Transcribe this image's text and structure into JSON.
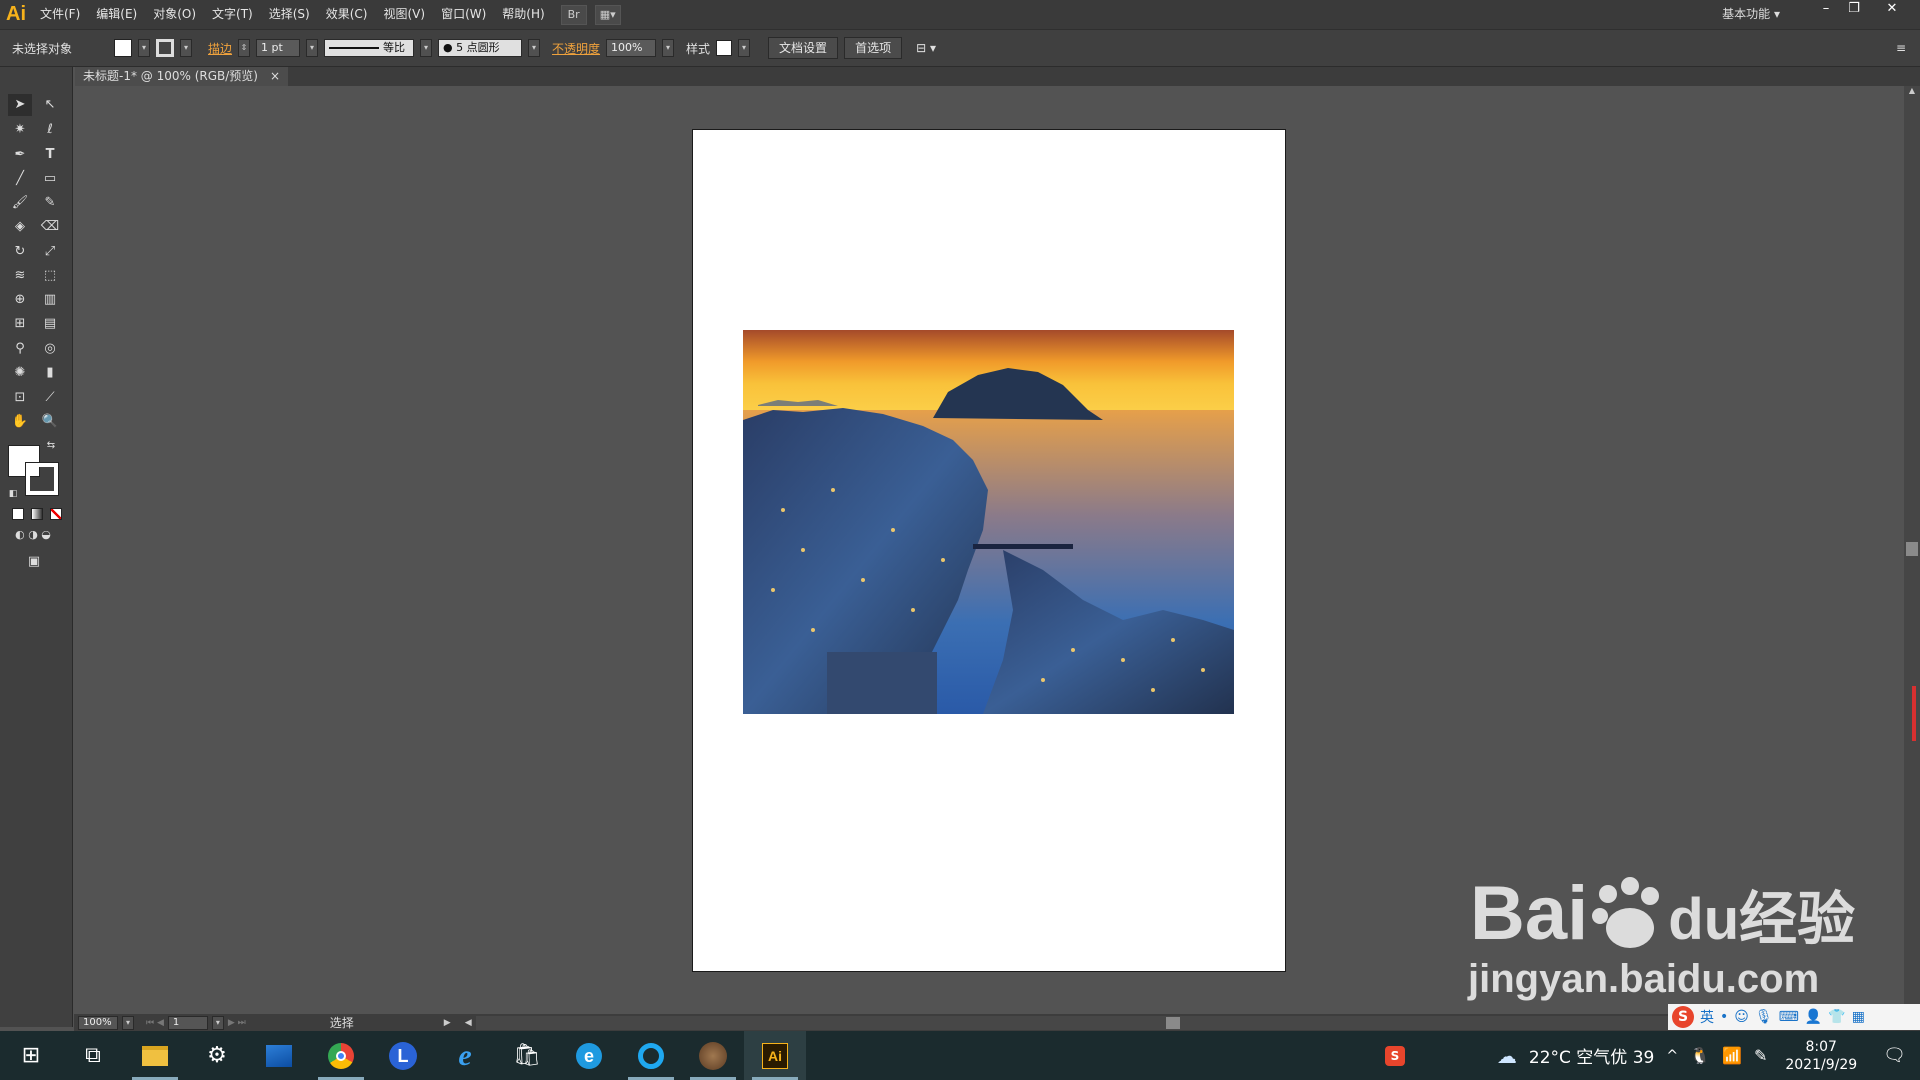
{
  "app": {
    "logo": "Ai"
  },
  "menu": [
    "文件(F)",
    "编辑(E)",
    "对象(O)",
    "文字(T)",
    "选择(S)",
    "效果(C)",
    "视图(V)",
    "窗口(W)",
    "帮助(H)"
  ],
  "workspace_label": "基本功能",
  "window_controls": {
    "minimize": "–",
    "restore": "❐",
    "close": "✕"
  },
  "control_bar": {
    "selection_status": "未选择对象",
    "stroke_label": "描边",
    "stroke_weight": "1 pt",
    "stroke_profile": "等比",
    "brush": "5 点圆形",
    "opacity_label": "不透明度",
    "opacity_value": "100%",
    "style_label": "样式",
    "doc_setup_button": "文档设置",
    "preferences_button": "首选项"
  },
  "document_tab": {
    "title": "未标题-1* @ 100% (RGB/预览)",
    "close": "×"
  },
  "status_bar": {
    "zoom": "100%",
    "page": "1",
    "tool": "选择"
  },
  "taskbar": {
    "weather": "22°C 空气优 39",
    "time": "8:07",
    "date": "2021/9/29",
    "apps": [
      "start-icon",
      "task-view-icon",
      "file-explorer-icon",
      "settings-icon",
      "photos-icon",
      "chrome-icon",
      "l-app-icon",
      "ie-icon",
      "store-icon",
      "edge-icon",
      "browser-q-icon",
      "photo-avatar-icon",
      "illustrator-icon"
    ]
  },
  "watermark": {
    "brand": "Bai",
    "suffix": "du经验",
    "url": "jingyan.baidu.com"
  },
  "colors": {
    "accent": "#f7b21b",
    "canvas": "#535353",
    "panel": "#404040"
  }
}
